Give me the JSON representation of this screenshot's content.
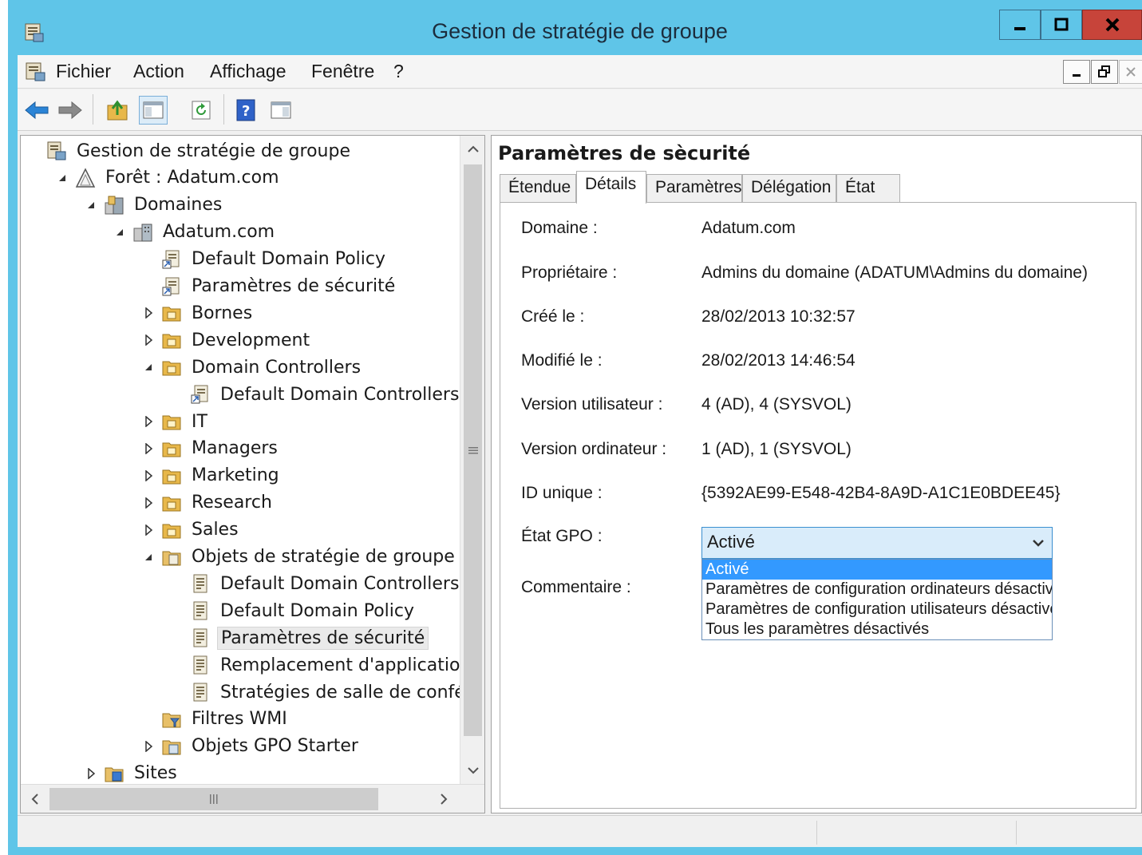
{
  "window": {
    "title": "Gestion de stratégie de groupe",
    "minimize": "_",
    "maximize": "□",
    "close": "X",
    "frame_color": "#5fc5e8",
    "close_color": "#c7443a"
  },
  "menu": {
    "items": [
      "Fichier",
      "Action",
      "Affichage",
      "Fenêtre",
      "?"
    ],
    "mdi_buttons": [
      "_",
      "🗗",
      "✕"
    ]
  },
  "toolbar": {
    "icons": [
      "back-icon",
      "forward-icon",
      "up-folder-icon",
      "show-hide-tree-icon",
      "refresh-icon",
      "help-icon",
      "action-pane-icon"
    ]
  },
  "tree": {
    "items": [
      {
        "label": "Gestion de stratégie de groupe",
        "icon": "gpmc-icon",
        "toggle": ""
      },
      {
        "label": "Forêt : Adatum.com",
        "icon": "forest-icon",
        "toggle": "expanded"
      },
      {
        "label": "Domaines",
        "icon": "domains-icon",
        "toggle": "expanded"
      },
      {
        "label": "Adatum.com",
        "icon": "domain-icon",
        "toggle": "expanded"
      },
      {
        "label": "Default Domain Policy",
        "icon": "gpo-link-icon",
        "toggle": ""
      },
      {
        "label": "Paramètres de sécurité",
        "icon": "gpo-link-icon",
        "toggle": ""
      },
      {
        "label": "Bornes",
        "icon": "ou-icon",
        "toggle": "collapsed"
      },
      {
        "label": "Development",
        "icon": "ou-icon",
        "toggle": "collapsed"
      },
      {
        "label": "Domain Controllers",
        "icon": "ou-icon",
        "toggle": "expanded"
      },
      {
        "label": "Default Domain Controllers Polic",
        "icon": "gpo-link-icon",
        "toggle": ""
      },
      {
        "label": "IT",
        "icon": "ou-icon",
        "toggle": "collapsed"
      },
      {
        "label": "Managers",
        "icon": "ou-icon",
        "toggle": "collapsed"
      },
      {
        "label": "Marketing",
        "icon": "ou-icon",
        "toggle": "collapsed"
      },
      {
        "label": "Research",
        "icon": "ou-icon",
        "toggle": "collapsed"
      },
      {
        "label": "Sales",
        "icon": "ou-icon",
        "toggle": "collapsed"
      },
      {
        "label": "Objets de stratégie de groupe",
        "icon": "gpo-container-icon",
        "toggle": "expanded"
      },
      {
        "label": "Default Domain Controllers Polic",
        "icon": "gpo-icon",
        "toggle": ""
      },
      {
        "label": "Default Domain Policy",
        "icon": "gpo-icon",
        "toggle": ""
      },
      {
        "label": "Paramètres de sécurité",
        "icon": "gpo-icon",
        "toggle": ""
      },
      {
        "label": "Remplacement d'application d'ir",
        "icon": "gpo-icon",
        "toggle": ""
      },
      {
        "label": "Stratégies de salle de conférence",
        "icon": "gpo-icon",
        "toggle": ""
      },
      {
        "label": "Filtres WMI",
        "icon": "wmi-filter-icon",
        "toggle": ""
      },
      {
        "label": "Objets GPO Starter",
        "icon": "starter-gpo-icon",
        "toggle": "collapsed"
      },
      {
        "label": "Sites",
        "icon": "sites-icon",
        "toggle": "collapsed"
      }
    ],
    "selected_index": 18
  },
  "details": {
    "heading": "Paramètres de sècurité",
    "tabs": [
      "Étendue",
      "Détails",
      "Paramètres",
      "Délégation",
      "État"
    ],
    "active_tab": 1,
    "fields": [
      {
        "label": "Domaine :",
        "value": "Adatum.com"
      },
      {
        "label": "Propriétaire :",
        "value": "Admins du domaine (ADATUM\\Admins du domaine)"
      },
      {
        "label": "Créé le :",
        "value": "28/02/2013 10:32:57"
      },
      {
        "label": "Modifié le :",
        "value": "28/02/2013 14:46:54"
      },
      {
        "label": "Version utilisateur :",
        "value": "4 (AD), 4 (SYSVOL)"
      },
      {
        "label": "Version ordinateur :",
        "value": "1 (AD), 1 (SYSVOL)"
      },
      {
        "label": "ID unique :",
        "value": "{5392AE99-E548-42B4-8A9D-A1C1E0BDEE45}"
      }
    ],
    "gpo_state_label": "État GPO :",
    "gpo_state_value": "Activé",
    "gpo_state_options": [
      "Activé",
      "Paramètres de configuration ordinateurs désactiv",
      "Paramètres de configuration utilisateurs désactive",
      "Tous les paramètres désactivés"
    ],
    "comment_label": "Commentaire :"
  }
}
